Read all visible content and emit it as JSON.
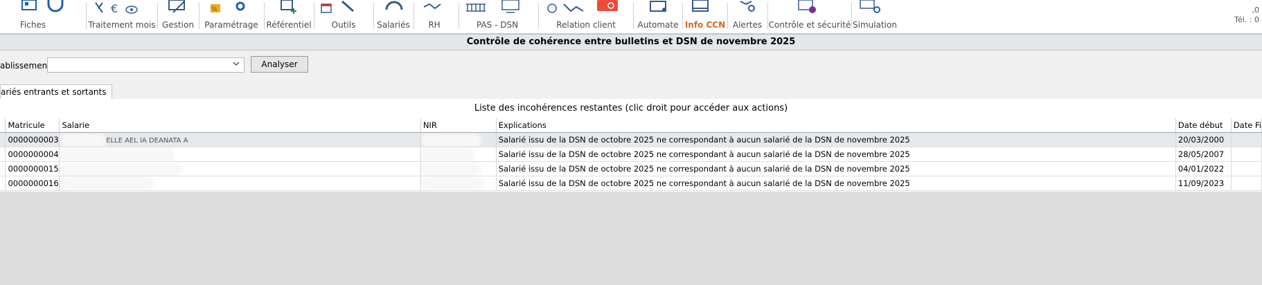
{
  "ribbon": {
    "groups": [
      {
        "label": "Fiches"
      },
      {
        "label": "Traitement mois"
      },
      {
        "label": "Gestion"
      },
      {
        "label": "Paramétrage"
      },
      {
        "label": "Référentiel"
      },
      {
        "label": "Outils"
      },
      {
        "label": "Salariés"
      },
      {
        "label": "RH"
      },
      {
        "label": "PAS - DSN"
      },
      {
        "label": "Relation client"
      },
      {
        "label": "Automate"
      },
      {
        "label": "Info CCN"
      },
      {
        "label": "Alertes"
      },
      {
        "label": "Contrôle et sécurité"
      },
      {
        "label": "Simulation"
      }
    ],
    "top_right": {
      "line1": ",0",
      "line2": "Tél. : 0"
    },
    "accent_color": "#d2691e"
  },
  "page": {
    "title": "Contrôle de cohérence entre bulletins et DSN de novembre 2025"
  },
  "filter": {
    "etablissement_label": "ablissement :",
    "etablissement_value": "",
    "analyse_button": "Analyser"
  },
  "tabs": [
    {
      "label": "ariés entrants et sortants"
    }
  ],
  "list": {
    "title": "Liste des incohérences restantes (clic droit pour accéder aux actions)",
    "columns": [
      "Matricule",
      "Salarie",
      "NIR",
      "Explications",
      "Date début",
      "Date Fi"
    ],
    "rows": [
      {
        "matricule": "0000000003",
        "salarie": "ELLE AEL IA DEANATA A",
        "nir": "",
        "explication": "Salarié issu de la DSN de octobre 2025 ne correspondant à aucun salarié de la DSN de novembre 2025",
        "date_debut": "20/03/2000",
        "date_fin": ""
      },
      {
        "matricule": "0000000004",
        "salarie": "",
        "nir": "",
        "explication": "Salarié issu de la DSN de octobre 2025 ne correspondant à aucun salarié de la DSN de novembre 2025",
        "date_debut": "28/05/2007",
        "date_fin": ""
      },
      {
        "matricule": "0000000015",
        "salarie": "",
        "nir": "",
        "explication": "Salarié issu de la DSN de octobre 2025 ne correspondant à aucun salarié de la DSN de novembre 2025",
        "date_debut": "04/01/2022",
        "date_fin": ""
      },
      {
        "matricule": "0000000016",
        "salarie": "",
        "nir": "",
        "explication": "Salarié issu de la DSN de octobre 2025 ne correspondant à aucun salarié de la DSN de novembre 2025",
        "date_debut": "11/09/2023",
        "date_fin": ""
      }
    ]
  }
}
